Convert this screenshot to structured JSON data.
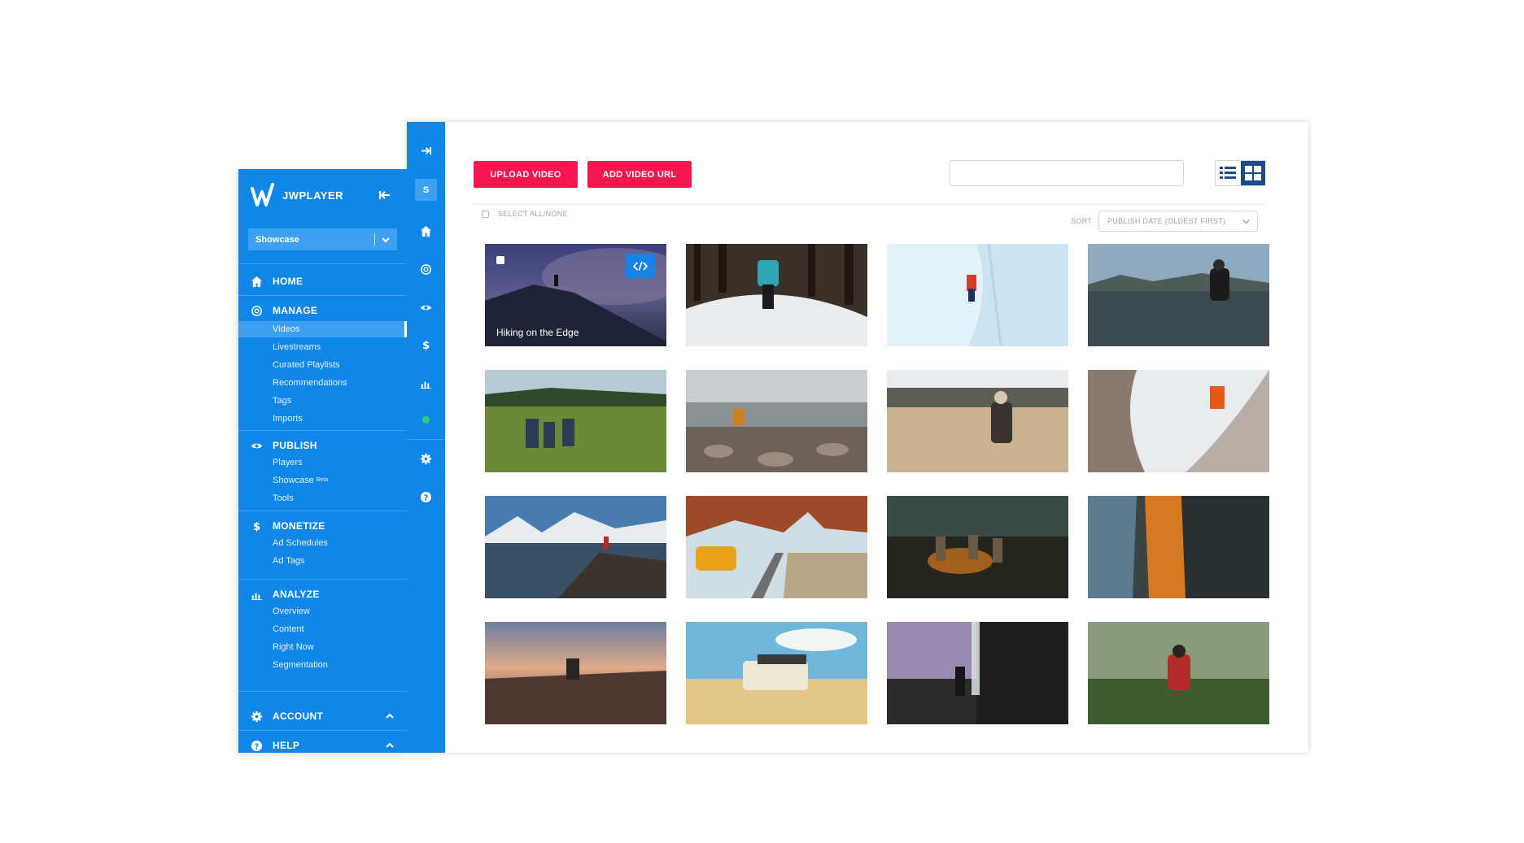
{
  "app": {
    "brand": "JWPLAYER",
    "property_select": "Showcase"
  },
  "rail": {
    "property_badge": "S",
    "icons": [
      "expand-icon",
      "home-icon",
      "manage-icon",
      "publish-eye-icon",
      "monetize-dollar-icon",
      "analyze-chart-icon",
      "status-dot-icon",
      "gear-icon",
      "help-icon"
    ]
  },
  "sidebar": {
    "sections": [
      {
        "title": "HOME",
        "icon": "home-icon"
      },
      {
        "title": "MANAGE",
        "icon": "manage-icon",
        "items": [
          "Videos",
          "Livestreams",
          "Curated Playlists",
          "Recommendations",
          "Tags",
          "Imports"
        ],
        "active": "Videos"
      },
      {
        "title": "PUBLISH",
        "icon": "eye-icon",
        "items": [
          "Players",
          "Showcase",
          "Tools"
        ],
        "badge": "Beta"
      },
      {
        "title": "MONETIZE",
        "icon": "dollar-icon",
        "items": [
          "Ad Schedules",
          "Ad Tags"
        ]
      },
      {
        "title": "ANALYZE",
        "icon": "chart-icon",
        "items": [
          "Overview",
          "Content",
          "Right Now",
          "Segmentation"
        ]
      },
      {
        "title": "ACCOUNT",
        "icon": "gear-icon"
      },
      {
        "title": "HELP",
        "icon": "help-icon"
      }
    ]
  },
  "toolbar": {
    "upload_label": "UPLOAD VIDEO",
    "add_url_label": "ADD VIDEO URL",
    "search_placeholder": ""
  },
  "list_controls": {
    "select_all_label": "SELECT ALL/NONE",
    "sort_label": "SORT",
    "sort_value": "PUBLISH DATE (OLDEST FIRST)"
  },
  "videos": [
    {
      "title": "Hiking on the Edge"
    }
  ],
  "colors": {
    "accent_blue": "#0f86e8",
    "button_red": "#f7164f",
    "grid_toggle_active": "#1e4a8a",
    "status_green": "#2fd16b"
  }
}
